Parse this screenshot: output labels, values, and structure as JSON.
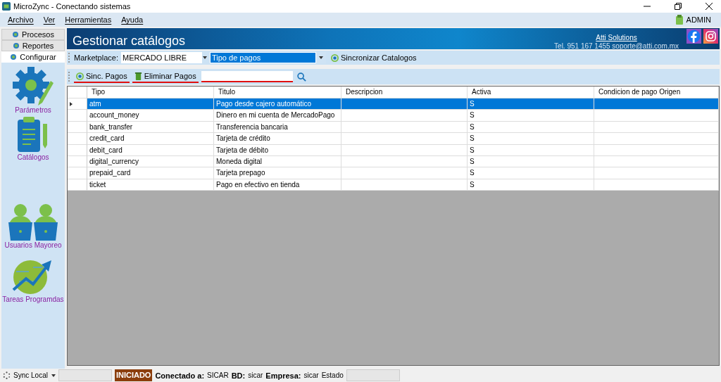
{
  "window": {
    "title": "MicroZync - Conectando sistemas",
    "user": "ADMIN"
  },
  "menu": [
    "Archivo",
    "Ver",
    "Herramientas",
    "Ayuda"
  ],
  "side_tabs": [
    {
      "label": "Procesos",
      "selected": false
    },
    {
      "label": "Reportes",
      "selected": false
    },
    {
      "label": "Configurar",
      "selected": true
    }
  ],
  "side_items": [
    {
      "label": "Parámetros",
      "kind": "gear"
    },
    {
      "label": "Catálogos",
      "kind": "clipboard"
    },
    {
      "label": "Usuarios Mayoreo",
      "kind": "users"
    },
    {
      "label": "Tareas Programdas",
      "kind": "globe"
    }
  ],
  "header": {
    "title": "Gestionar catálogos",
    "company": "Atti Solutions",
    "contact": "Tel. 951 167 1455  soporte@atti.com.mx"
  },
  "toolbar": {
    "marketplace_label": "Marketplace:",
    "marketplace": "MERCADO LIBRE",
    "catalog": "Tipo de pagos",
    "sync_button": "Sincronizar Catalogos"
  },
  "actions": {
    "sync": "Sinc. Pagos",
    "delete": "Eliminar Pagos"
  },
  "table": {
    "columns": [
      "Tipo",
      "Titulo",
      "Descripcion",
      "Activa",
      "Condicion de pago Origen"
    ],
    "rows": [
      {
        "cells": [
          "atm",
          "Pago desde cajero automático",
          "",
          "S",
          ""
        ],
        "selected": true
      },
      {
        "cells": [
          "account_money",
          "Dinero en mi cuenta de MercadoPago",
          "",
          "S",
          ""
        ],
        "selected": false
      },
      {
        "cells": [
          "bank_transfer",
          "Transferencia bancaria",
          "",
          "S",
          ""
        ],
        "selected": false
      },
      {
        "cells": [
          "credit_card",
          "Tarjeta de crédito",
          "",
          "S",
          ""
        ],
        "selected": false
      },
      {
        "cells": [
          "debit_card",
          "Tarjeta de débito",
          "",
          "S",
          ""
        ],
        "selected": false
      },
      {
        "cells": [
          "digital_currency",
          "Moneda digital",
          "",
          "S",
          ""
        ],
        "selected": false
      },
      {
        "cells": [
          "prepaid_card",
          "Tarjeta prepago",
          "",
          "S",
          ""
        ],
        "selected": false
      },
      {
        "cells": [
          "ticket",
          "Pago en efectivo en tienda",
          "",
          "S",
          ""
        ],
        "selected": false
      }
    ]
  },
  "status_bar": {
    "sync": "Sync Local",
    "state": "INICIADO",
    "items": [
      {
        "label": "Conectado a:",
        "value": "SICAR"
      },
      {
        "label": "BD:",
        "value": "sicar"
      },
      {
        "label": "Empresa:",
        "value": "sicar"
      }
    ],
    "estado": "Estado"
  }
}
